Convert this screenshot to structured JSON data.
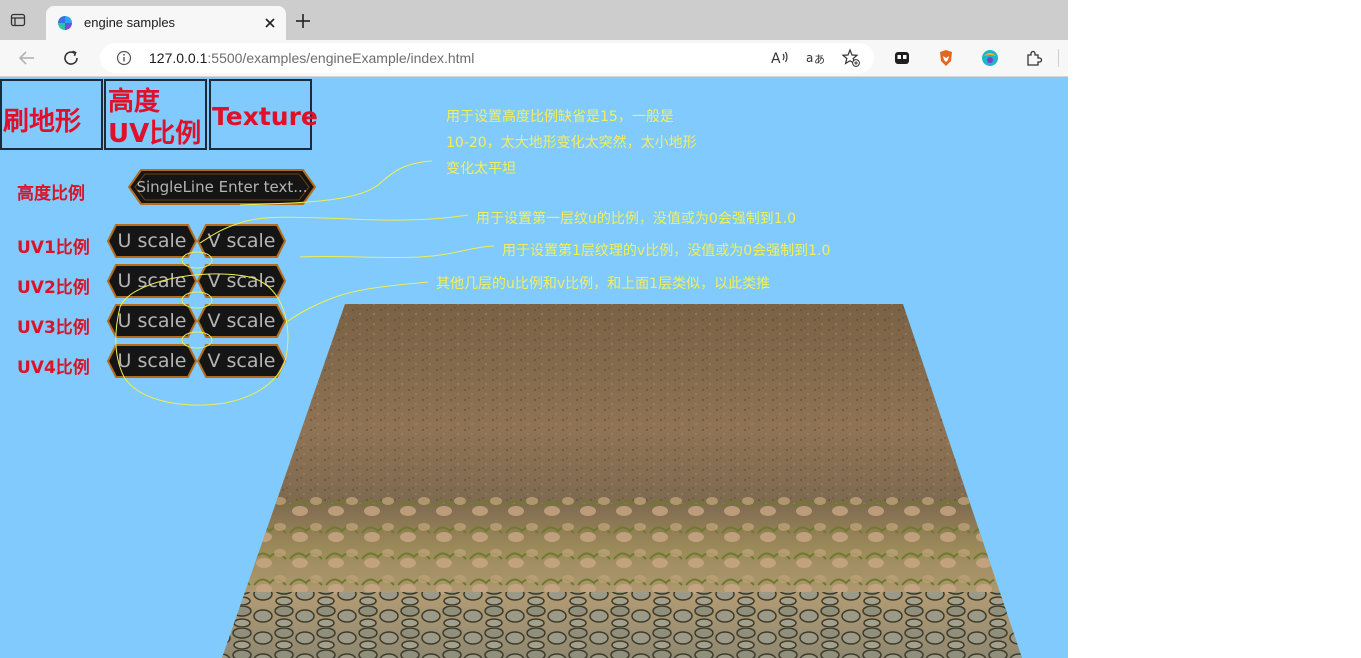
{
  "browser": {
    "tab_title": "engine samples",
    "url_host": "127.0.0.1",
    "url_rest": ":5500/examples/engineExample/index.html",
    "icons": [
      "tab-actions-icon",
      "favicon-icon",
      "close-icon",
      "new-tab-icon",
      "back-icon",
      "refresh-icon",
      "info-icon",
      "read-aloud-icon",
      "translate-icon",
      "favorites-icon",
      "collections-icon",
      "brave-extension-icon",
      "extension-icon",
      "extensions-puzzle-icon"
    ]
  },
  "page": {
    "background_color": "#80cafd",
    "buttons": {
      "brush": "刷地形",
      "height_uv_line1": "高度",
      "height_uv_line2": "UV比例",
      "texture": "Texture"
    },
    "height_ratio": {
      "label": "高度比例",
      "placeholder": "SingleLine Enter text..."
    },
    "uv_rows": [
      {
        "label": "UV1比例",
        "u_placeholder": "U scale",
        "v_placeholder": "V scale"
      },
      {
        "label": "UV2比例",
        "u_placeholder": "U scale",
        "v_placeholder": "V scale"
      },
      {
        "label": "UV3比例",
        "u_placeholder": "U scale",
        "v_placeholder": "V scale"
      },
      {
        "label": "UV4比例",
        "u_placeholder": "U scale",
        "v_placeholder": "V scale"
      }
    ],
    "annotations": {
      "height_line1": "用于设置高度比例缺省是15，一般是",
      "height_line2": "10-20，太大地形变化太突然，太小地形",
      "height_line3": "变化太平坦",
      "u_note": "用于设置第一层纹u的比例，没值或为0会强制到1.0",
      "v_note": "用于设置第1层纹理的v比例，没值或为0会强制到1.0",
      "others_note": "其他几层的u比例和v比例，和上面1层类似，以此类推"
    },
    "annotation_color": "#f1f05a"
  }
}
